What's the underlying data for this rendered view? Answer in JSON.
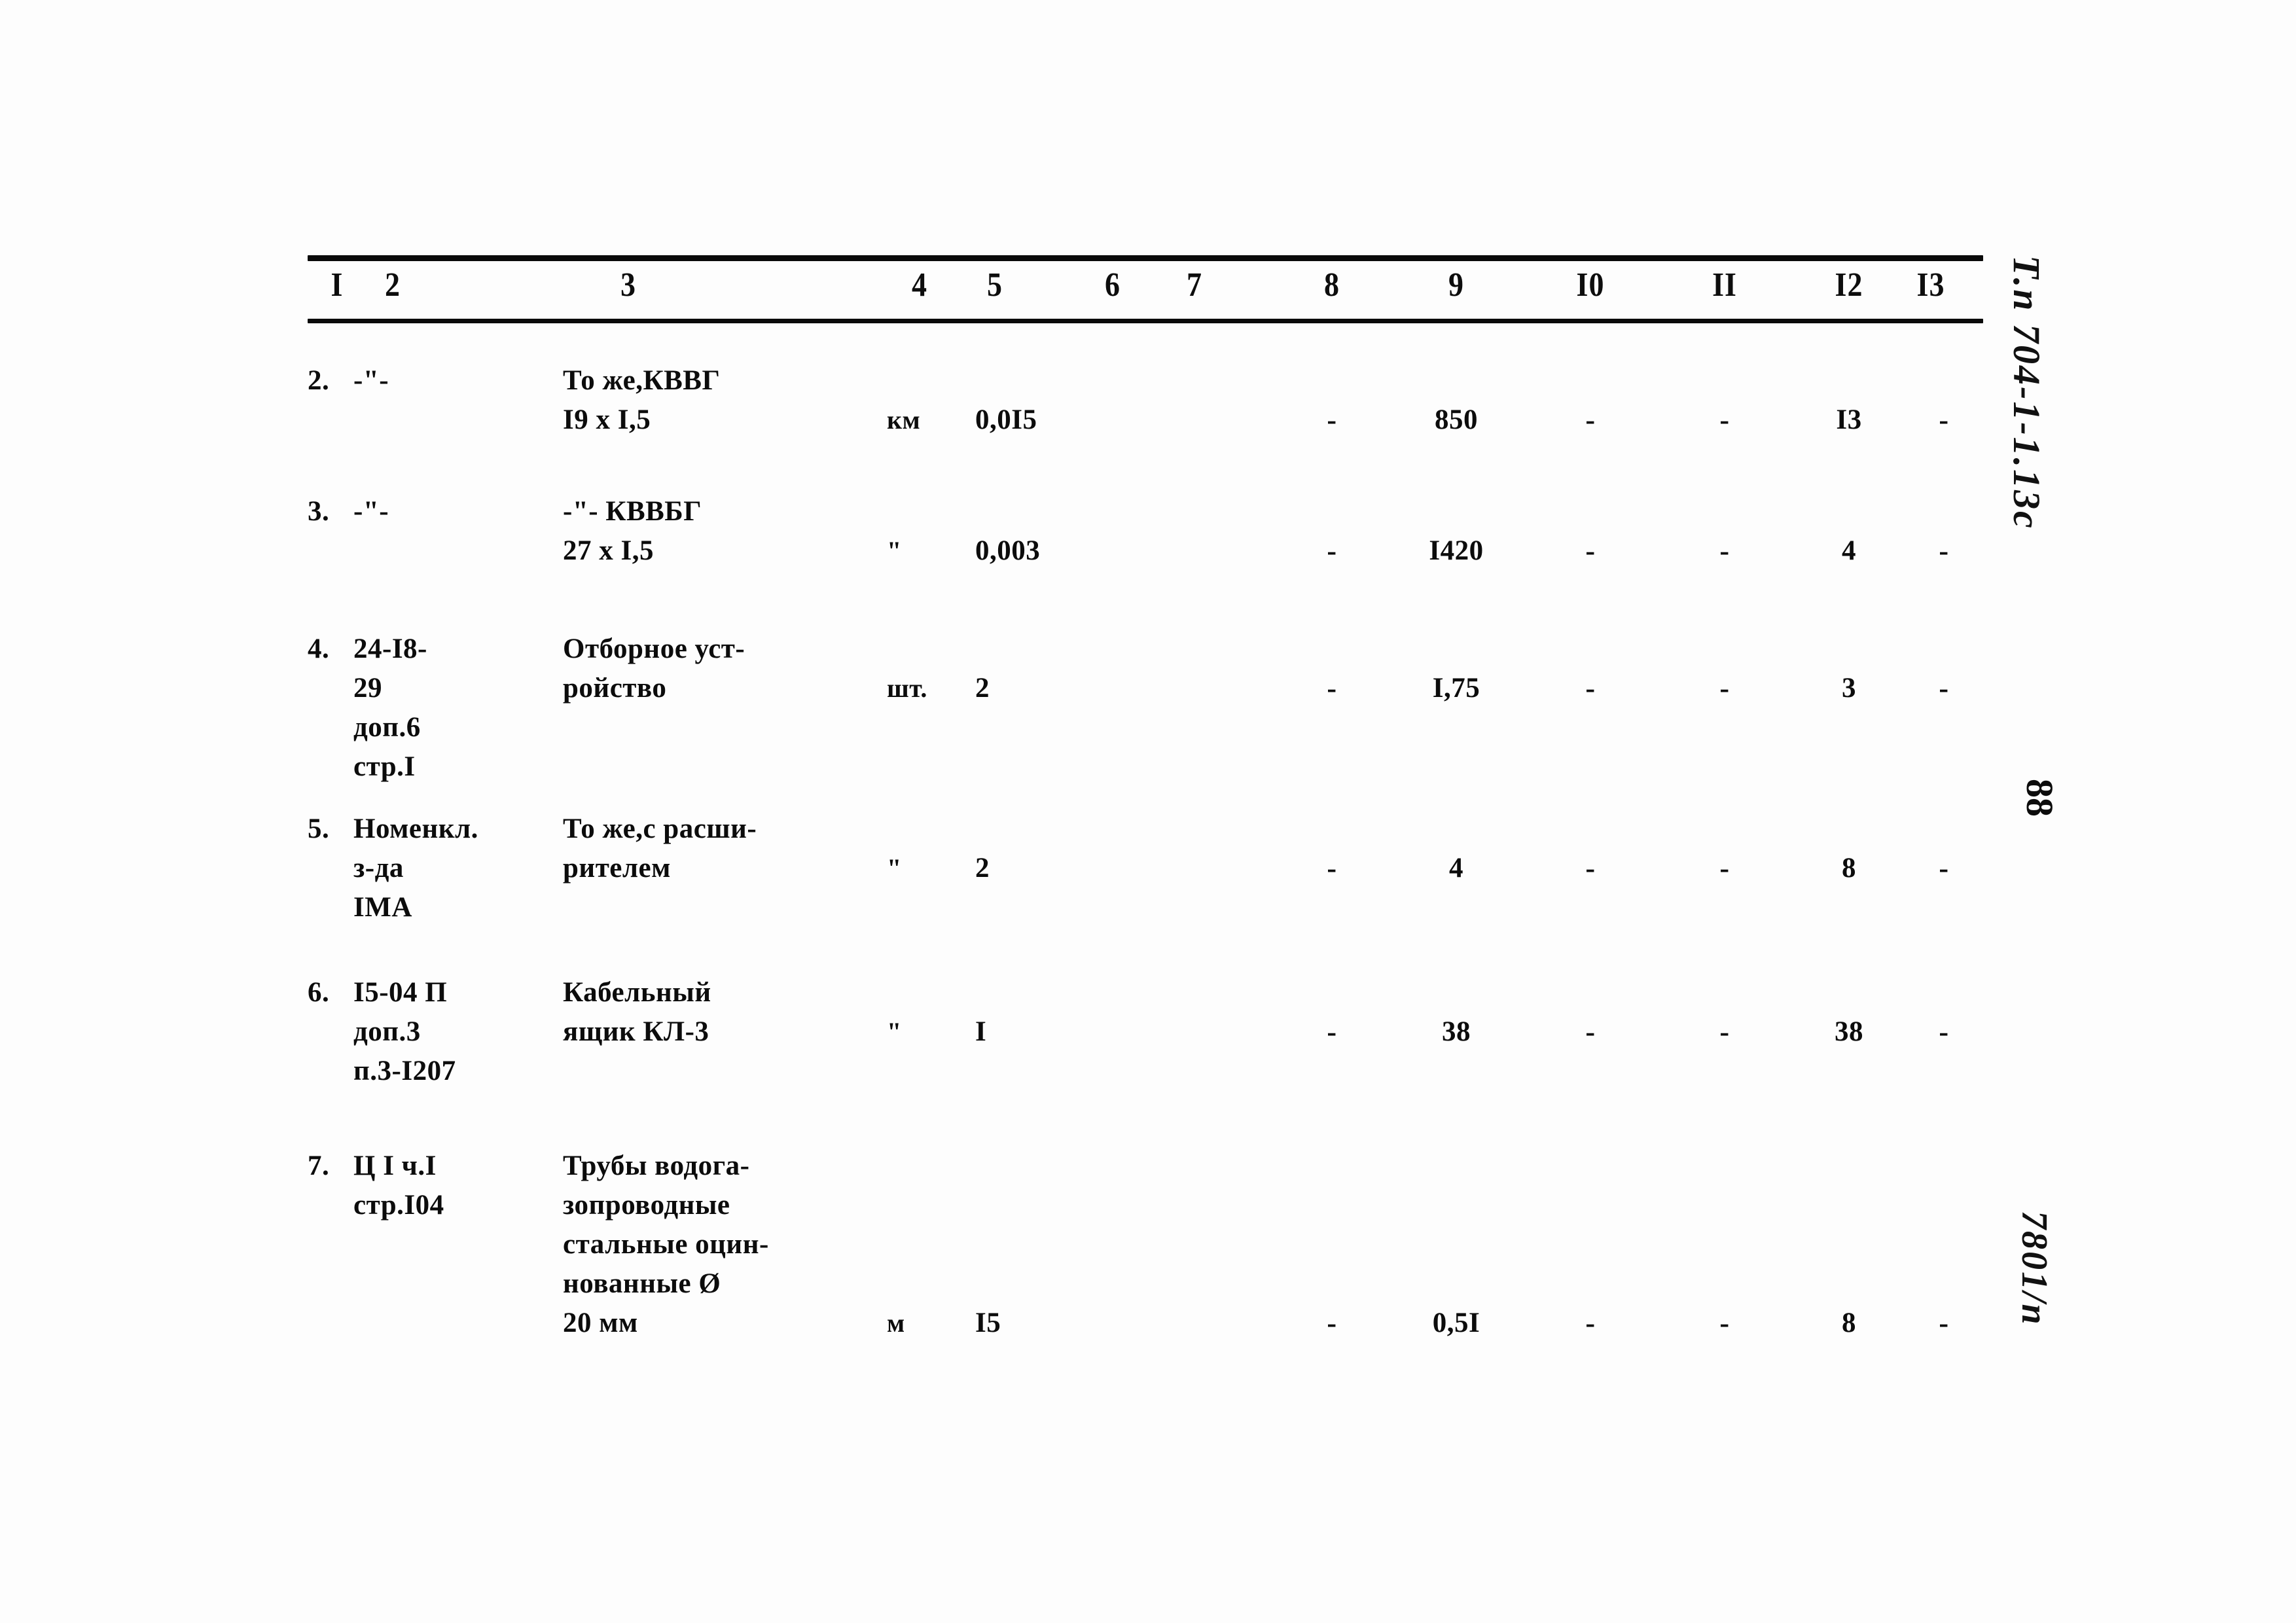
{
  "document": {
    "type": "specification-table",
    "page_number": "88",
    "margin_notes": {
      "project_code": "Т.п 704-1-1.13с",
      "archive_code": "7801/п"
    }
  },
  "table": {
    "column_headers": [
      "I",
      "2",
      "3",
      "4",
      "5",
      "6",
      "7",
      "8",
      "9",
      "I0",
      "II",
      "I2",
      "I3"
    ],
    "rows": [
      {
        "num": "2.",
        "code": "-\"-",
        "name": "То же,КВВГ\nI9 x I,5",
        "unit": "км",
        "qty": "0,0I5",
        "c6": "",
        "c7": "",
        "c8": "-",
        "c9": "850",
        "c10": "-",
        "c11": "-",
        "c12": "I3",
        "c13": "-"
      },
      {
        "num": "3.",
        "code": "-\"-",
        "name": "-\"- КВВБГ\n27 x I,5",
        "unit": "\"",
        "qty": "0,003",
        "c6": "",
        "c7": "",
        "c8": "-",
        "c9": "I420",
        "c10": "-",
        "c11": "-",
        "c12": "4",
        "c13": "-"
      },
      {
        "num": "4.",
        "code": "24-I8-\n29\nдоп.6\nстр.I",
        "name": "Отборное уст-\nройство",
        "unit": "шт.",
        "qty": "2",
        "c6": "",
        "c7": "",
        "c8": "-",
        "c9": "I,75",
        "c10": "-",
        "c11": "-",
        "c12": "3",
        "c13": "-"
      },
      {
        "num": "5.",
        "code": "Номенкл.\nз-да\nIМА",
        "name": "То же,с расши-\nрителем",
        "unit": "\"",
        "qty": "2",
        "c6": "",
        "c7": "",
        "c8": "-",
        "c9": "4",
        "c10": "-",
        "c11": "-",
        "c12": "8",
        "c13": "-"
      },
      {
        "num": "6.",
        "code": "I5-04 П\nдоп.3\nп.3-I207",
        "name": "Кабельный\nящик КЛ-3",
        "unit": "\"",
        "qty": "I",
        "c6": "",
        "c7": "",
        "c8": "-",
        "c9": "38",
        "c10": "-",
        "c11": "-",
        "c12": "38",
        "c13": "-"
      },
      {
        "num": "7.",
        "code": "Ц I ч.I\nстр.I04",
        "name": "Трубы водога-\nзопроводные\nстальные оцин-\nнованные Ø\n20 мм",
        "unit": "м",
        "qty": "I5",
        "c6": "",
        "c7": "",
        "c8": "-",
        "c9": "0,5I",
        "c10": "-",
        "c11": "-",
        "c12": "8",
        "c13": "-"
      }
    ]
  }
}
